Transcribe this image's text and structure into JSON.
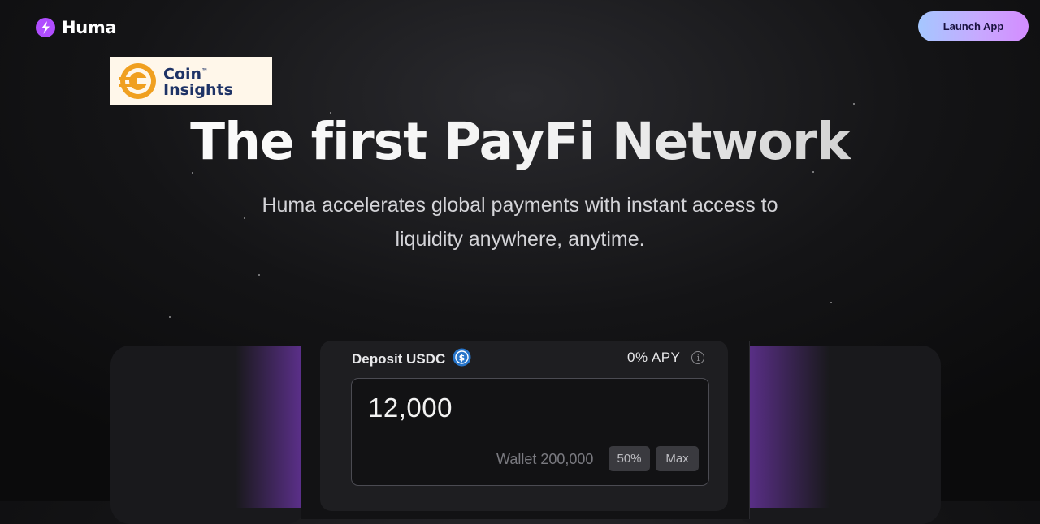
{
  "header": {
    "brand": "Huma",
    "launch_label": "Launch App"
  },
  "watermark": {
    "line1": "Coin",
    "tm": "™",
    "line2": "Insights"
  },
  "hero": {
    "title": "The first PayFi Network",
    "subtitle_line1": "Huma accelerates global payments with instant access to",
    "subtitle_line2": "liquidity anywhere, anytime."
  },
  "deposit": {
    "label": "Deposit USDC",
    "apy": "0% APY",
    "amount": "12,000",
    "wallet": "Wallet 200,000",
    "half_label": "50%",
    "max_label": "Max"
  },
  "colors": {
    "accent_purple": "#b04dff",
    "usdc_blue": "#2775ca",
    "launch_gradient": [
      "#a5c7ff",
      "#d48cff"
    ]
  },
  "icons": {
    "logo": "huma-bolt-icon",
    "token": "usdc-icon",
    "info": "info-icon"
  }
}
